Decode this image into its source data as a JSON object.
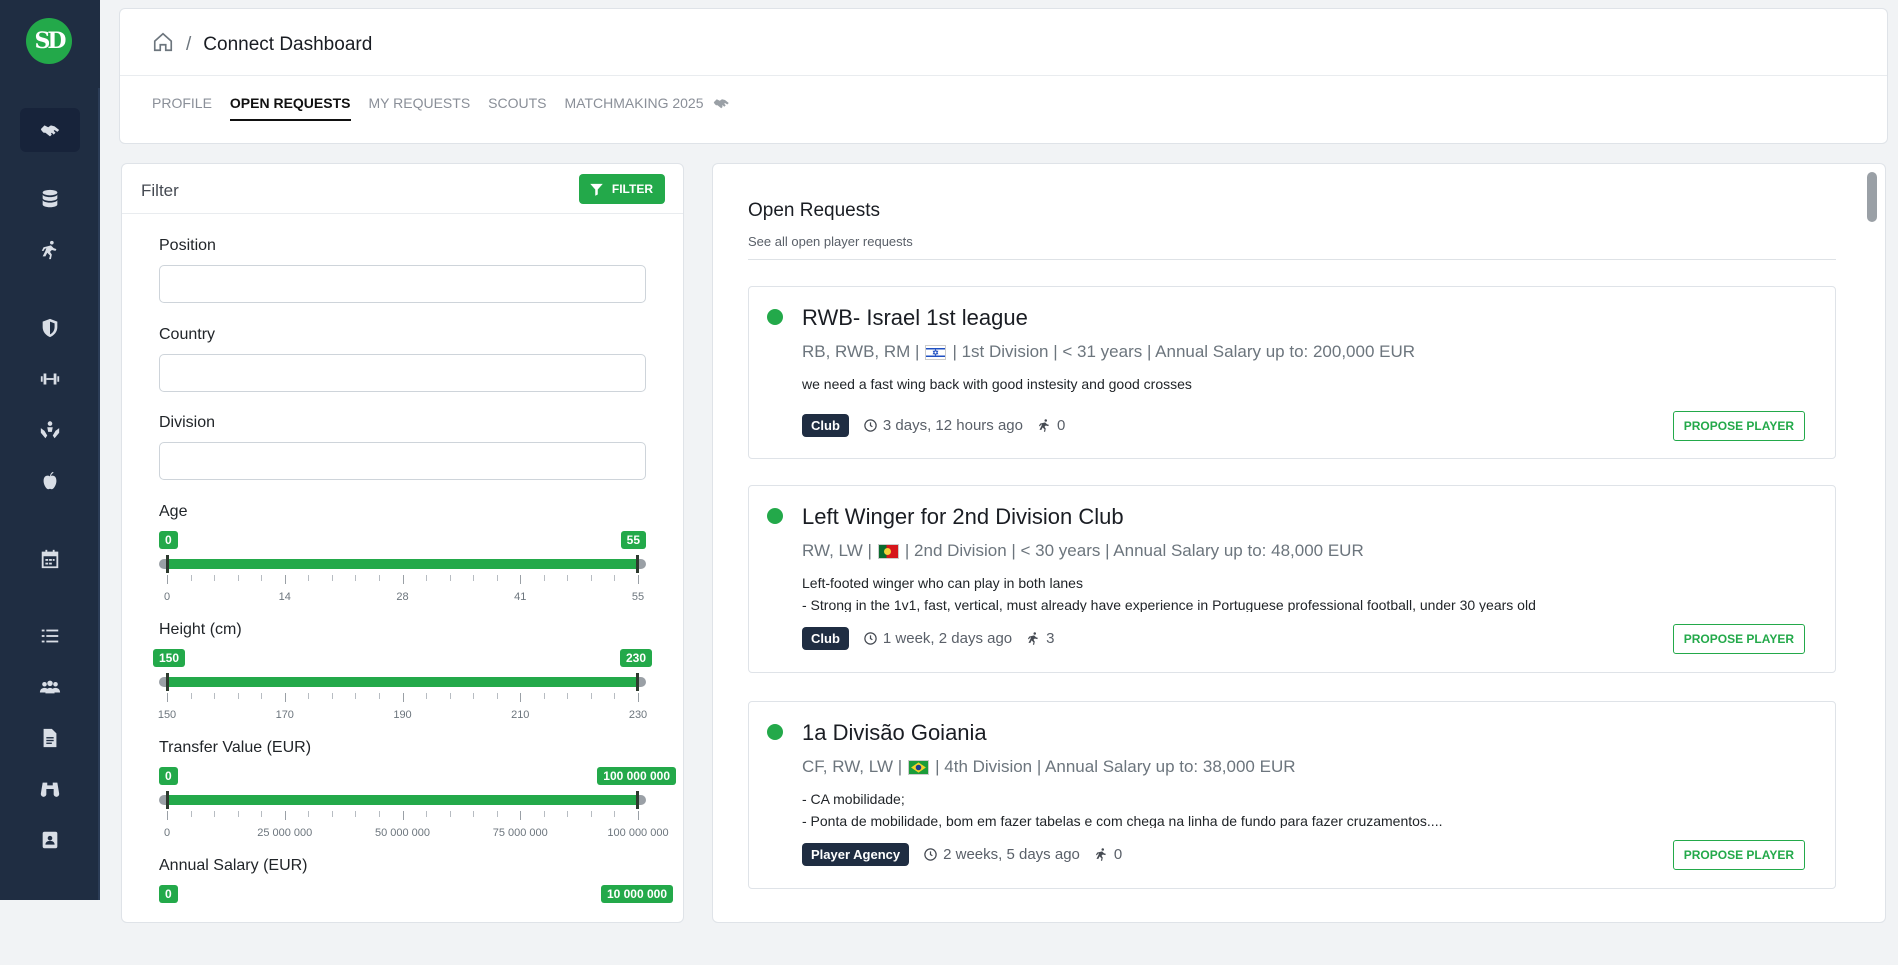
{
  "app": {
    "logo_text": "SD"
  },
  "sidebar": {
    "icons": [
      "handshake-icon",
      "database-icon",
      "runner-icon",
      "shield-icon",
      "dumbbell-icon",
      "hands-people-icon",
      "apple-icon",
      "calendar-icon",
      "list-icon",
      "users-icon",
      "document-icon",
      "binoculars-icon",
      "contact-card-icon"
    ]
  },
  "header": {
    "title": "Connect Dashboard",
    "separator": "/",
    "tabs": [
      {
        "label": "PROFILE"
      },
      {
        "label": "OPEN REQUESTS"
      },
      {
        "label": "MY REQUESTS"
      },
      {
        "label": "SCOUTS"
      },
      {
        "label": "MATCHMAKING 2025"
      }
    ]
  },
  "filter": {
    "title": "Filter",
    "button_label": "FILTER",
    "fields": [
      {
        "label": "Position",
        "value": ""
      },
      {
        "label": "Country",
        "value": ""
      },
      {
        "label": "Division",
        "value": ""
      }
    ],
    "sliders": [
      {
        "label": "Age",
        "min_value": "0",
        "max_value": "55",
        "ticks": [
          "0",
          "14",
          "28",
          "41",
          "55"
        ]
      },
      {
        "label": "Height (cm)",
        "min_value": "150",
        "max_value": "230",
        "ticks": [
          "150",
          "170",
          "190",
          "210",
          "230"
        ]
      },
      {
        "label": "Transfer Value (EUR)",
        "min_value": "0",
        "max_value": "100 000 000",
        "ticks": [
          "0",
          "25 000 000",
          "50 000 000",
          "75 000 000",
          "100 000 000"
        ]
      },
      {
        "label": "Annual Salary (EUR)",
        "min_value": "0",
        "max_value": "10 000 000"
      }
    ]
  },
  "requests": {
    "title": "Open Requests",
    "subtitle": "See all open player requests",
    "cards": [
      {
        "title": "RWB- Israel 1st league",
        "positions": "RB, RWB, RM |",
        "flag": "israel",
        "details": "| 1st Division | < 31 years | Annual Salary up to: 200,000 EUR",
        "description": [
          "we need a fast wing back with good instesity and good crosses"
        ],
        "tag": "Club",
        "time": "3 days, 12 hours ago",
        "proposals": "0",
        "button": "PROPOSE PLAYER"
      },
      {
        "title": "Left Winger for 2nd Division Club",
        "positions": "RW, LW |",
        "flag": "portugal",
        "details": "| 2nd Division | < 30 years | Annual Salary up to: 48,000 EUR",
        "description": [
          "Left-footed winger who can play in both lanes",
          "- Strong in the 1v1, fast, vertical, must already have experience in Portuguese professional football, under 30 years old"
        ],
        "tag": "Club",
        "time": "1 week, 2 days ago",
        "proposals": "3",
        "button": "PROPOSE PLAYER"
      },
      {
        "title": "1a Divisão Goiania",
        "positions": "CF, RW, LW |",
        "flag": "brazil",
        "details": "| 4th Division | Annual Salary up to: 38,000 EUR",
        "description": [
          "- CA mobilidade;",
          "- Ponta de mobilidade, bom em fazer tabelas e com chega na linha de fundo para fazer cruzamentos...."
        ],
        "tag": "Player Agency",
        "time": "2 weeks, 5 days ago",
        "proposals": "0",
        "button": "PROPOSE PLAYER"
      }
    ]
  },
  "colors": {
    "accent": "#23a94a",
    "sidebar": "#1f2d42",
    "tag": "#1f2d42"
  }
}
